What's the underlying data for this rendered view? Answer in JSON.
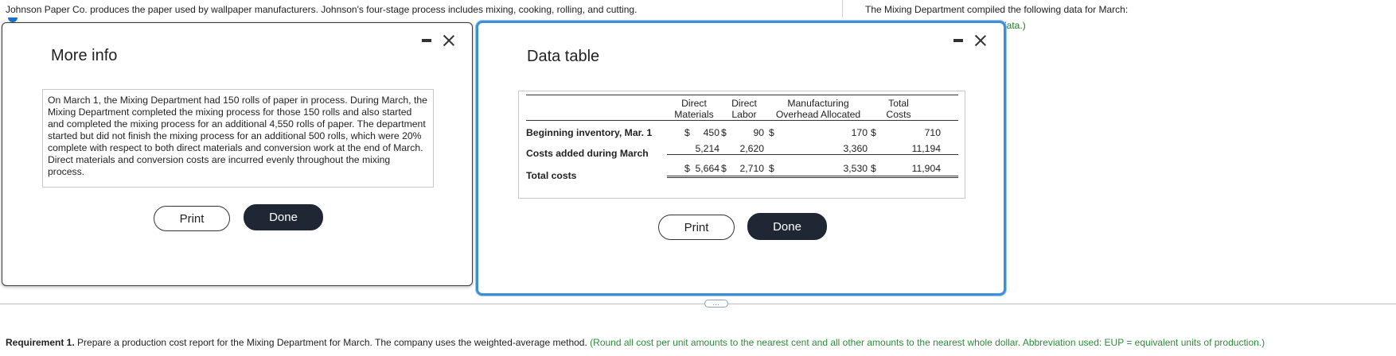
{
  "header": {
    "intro": "Johnson Paper Co. produces the paper used by wallpaper manufacturers. Johnson's four-stage process includes mixing, cooking, rolling, and cutting.",
    "mixing_text": "The Mixing Department compiled the following data for March:",
    "link_fragment": "data.)"
  },
  "more_info": {
    "title": "More info",
    "body": "On March 1, the Mixing Department had 150 rolls of paper in process. During March, the Mixing Department completed the mixing process for those 150 rolls and also started and completed the mixing process for an additional 4,550 rolls of paper. The department started but did not finish the mixing process for an additional 500 rolls, which were 20% complete with respect to both direct materials and conversion work at the end of March. Direct materials and conversion costs are incurred evenly throughout the mixing process.",
    "print_label": "Print",
    "done_label": "Done"
  },
  "data_table": {
    "title": "Data table",
    "headers": {
      "dm1": "Direct",
      "dm2": "Materials",
      "dl1": "Direct",
      "dl2": "Labor",
      "moh1": "Manufacturing",
      "moh2": "Overhead Allocated",
      "tc1": "Total",
      "tc2": "Costs"
    },
    "rows": [
      {
        "label": "Beginning inventory, Mar. 1",
        "dm_sym": "$",
        "dm": "450",
        "dl_sym": "$",
        "dl": "90",
        "moh_sym": "$",
        "moh": "170",
        "tc_sym": "$",
        "tc": "710"
      },
      {
        "label": "Costs added during March",
        "dm_sym": "",
        "dm": "5,214",
        "dl_sym": "",
        "dl": "2,620",
        "moh_sym": "",
        "moh": "3,360",
        "tc_sym": "",
        "tc": "11,194"
      },
      {
        "label": "Total costs",
        "dm_sym": "$",
        "dm": "5,664",
        "dl_sym": "$",
        "dl": "2,710",
        "moh_sym": "$",
        "moh": "3,530",
        "tc_sym": "$",
        "tc": "11,904"
      }
    ],
    "print_label": "Print",
    "done_label": "Done"
  },
  "requirement": {
    "label": "Requirement 1.",
    "text": " Prepare a production cost report for the Mixing Department for March. The company uses the weighted-average method. ",
    "note": "(Round all cost per unit amounts to the nearest cent and all other amounts to the nearest whole dollar. Abbreviation used: EUP = equivalent units of production.)"
  },
  "handle_glyph": "…",
  "colors": {
    "accent_blue": "#3d8fd6",
    "done_button": "#1e2733",
    "note_green": "#2e8b3a"
  }
}
